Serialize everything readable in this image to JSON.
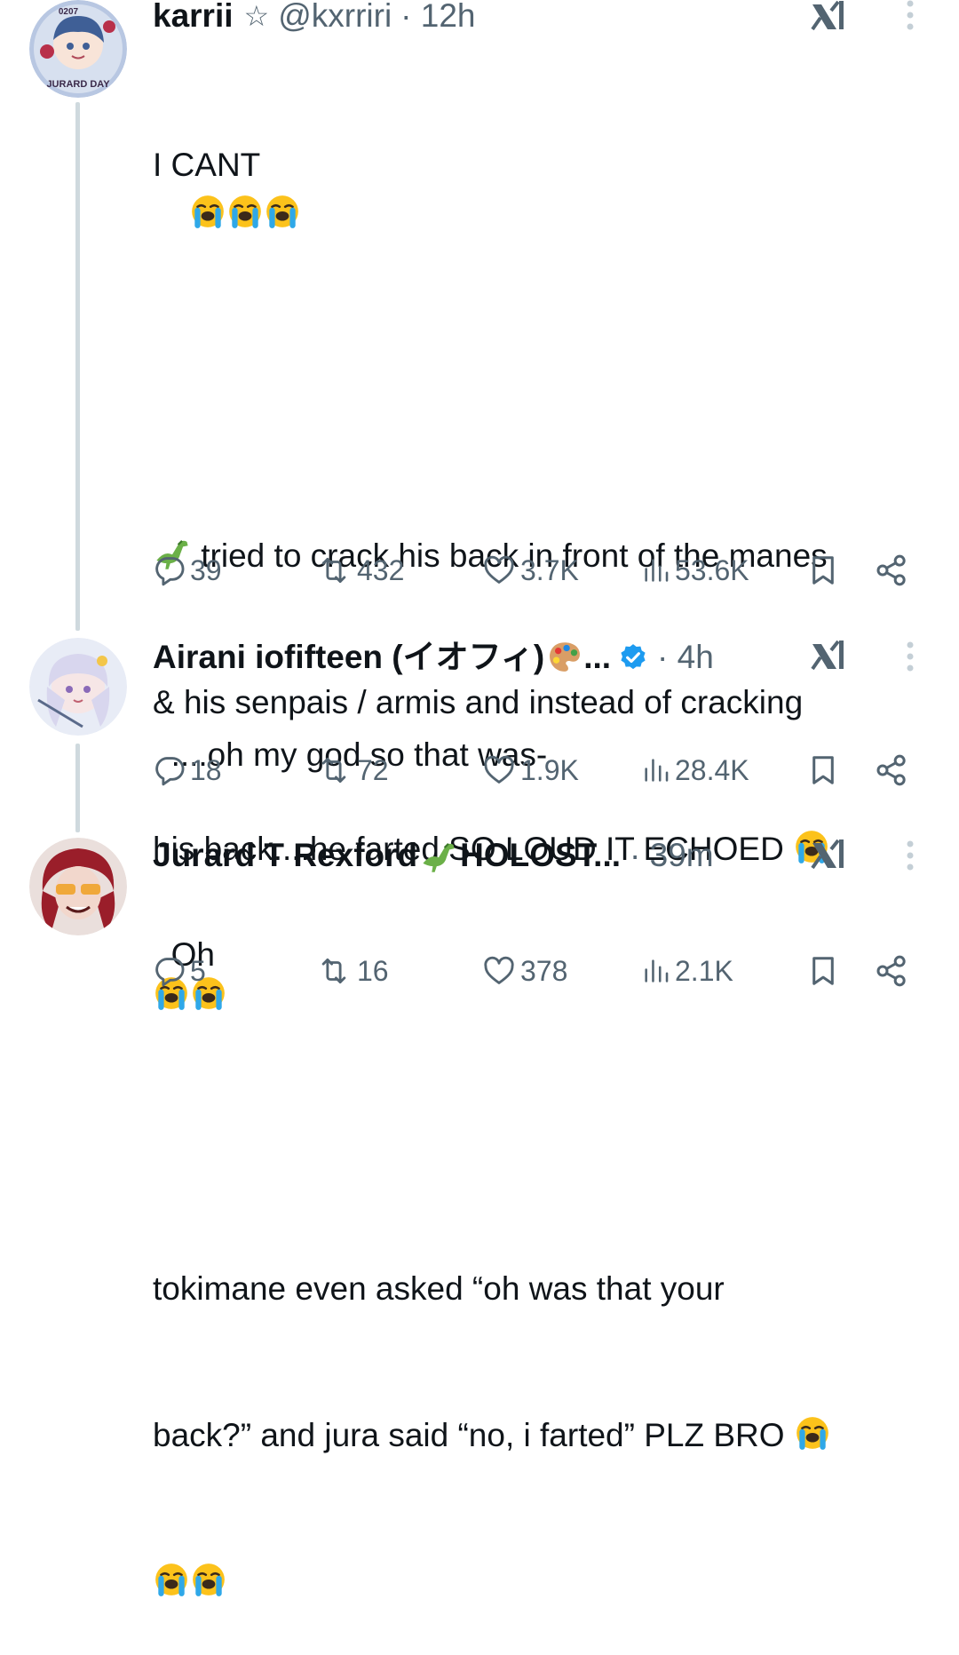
{
  "tweets": [
    {
      "name": "karrii",
      "star": "☆",
      "handle": "@kxrriri",
      "time": "· 12h",
      "avatar_text": "JURARD DAY",
      "avatar_num": "0207",
      "line1": "I CANT",
      "line2": " tried to crack his back in front of the manes",
      "line3": "& his senpais / armis and instead of cracking",
      "line4": "his back....he farted SO LOUD IT ECHOED",
      "line5": "tokimane even asked “oh was that your",
      "line6": "back?” and jura said “no, i farted” PLZ BRO",
      "replies": "39",
      "reposts": "432",
      "likes": "3.7K",
      "views": "53.6K"
    },
    {
      "name": "Airani iofifteen (イオフィ)",
      "ellipsis": "...",
      "time": "· 4h",
      "text": "....oh my god so that was-",
      "replies": "18",
      "reposts": "72",
      "likes": "1.9K",
      "views": "28.4K"
    },
    {
      "name_a": "Jurard T Rexford",
      "name_b": "HOLOST...",
      "time": "· 39m",
      "text": "Oh",
      "replies": "5",
      "reposts": "16",
      "likes": "378",
      "views": "2.1K"
    }
  ],
  "icons": [
    "reply-icon",
    "repost-icon",
    "like-icon",
    "views-icon",
    "bookmark-icon",
    "share-icon",
    "grok-icon",
    "more-icon",
    "verified-icon",
    "crying-emoji",
    "dinosaur-emoji",
    "palette-emoji"
  ],
  "colors": {
    "text": "#0f1419",
    "muted": "#536471",
    "line": "#cfd9de",
    "verified": "#1d9bf0"
  }
}
